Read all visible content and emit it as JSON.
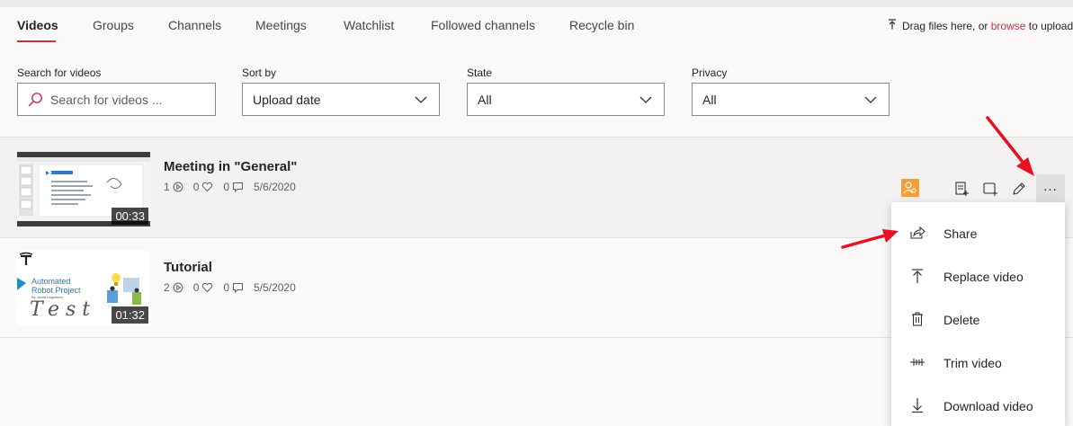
{
  "tabs": [
    {
      "label": "Videos",
      "active": true
    },
    {
      "label": "Groups"
    },
    {
      "label": "Channels"
    },
    {
      "label": "Meetings"
    },
    {
      "label": "Watchlist"
    },
    {
      "label": "Followed channels"
    },
    {
      "label": "Recycle bin"
    }
  ],
  "upload": {
    "prefix": "Drag files here, or ",
    "link": "browse",
    "suffix": " to upload"
  },
  "filters": {
    "search": {
      "label": "Search for videos",
      "placeholder": "Search for videos ..."
    },
    "sort": {
      "label": "Sort by",
      "value": "Upload date"
    },
    "state": {
      "label": "State",
      "value": "All"
    },
    "privacy": {
      "label": "Privacy",
      "value": "All"
    }
  },
  "videos": [
    {
      "title": "Meeting in \"General\"",
      "views": "1",
      "likes": "0",
      "comments": "0",
      "date": "5/6/2020",
      "duration": "00:33"
    },
    {
      "title": "Tutorial",
      "views": "2",
      "likes": "0",
      "comments": "0",
      "date": "5/5/2020",
      "duration": "01:32",
      "thumb_text": {
        "line1": "Automated",
        "line2": "Robot Project",
        "line3": "By: Anna Lagsbunn",
        "handwriting": "Test"
      }
    }
  ],
  "row_actions": {
    "more_label": "..."
  },
  "menu": [
    {
      "label": "Share",
      "icon": "share-icon"
    },
    {
      "label": "Replace video",
      "icon": "upload-icon"
    },
    {
      "label": "Delete",
      "icon": "trash-icon"
    },
    {
      "label": "Trim video",
      "icon": "trim-icon"
    },
    {
      "label": "Download video",
      "icon": "download-icon"
    }
  ],
  "colors": {
    "accent": "#c4314b",
    "badge": "#f2a033",
    "annotation": "#e81123"
  }
}
